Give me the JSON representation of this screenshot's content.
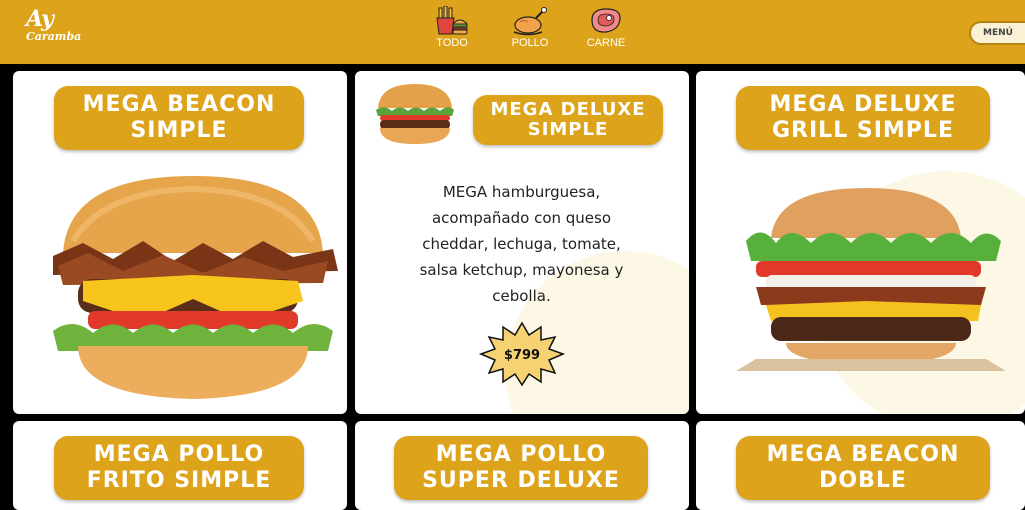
{
  "header": {
    "logo_line1": "Ay",
    "logo_line2": "Caramba",
    "nav": [
      {
        "label": "TODO",
        "icon": "fries-burger-icon"
      },
      {
        "label": "POLLO",
        "icon": "roast-chicken-icon"
      },
      {
        "label": "CARNE",
        "icon": "steak-icon"
      }
    ],
    "menu_label": "MENÚ"
  },
  "cards": [
    {
      "title_line1": "MEGA BEACON",
      "title_line2": "SIMPLE"
    },
    {
      "title_line1": "MEGA DELUXE",
      "title_line2": "SIMPLE",
      "description": [
        "MEGA hamburguesa,",
        "acompañado con queso",
        "cheddar, lechuga, tomate,",
        "salsa ketchup, mayonesa y",
        "cebolla."
      ],
      "price": "$799"
    },
    {
      "title_line1": "MEGA DELUXE",
      "title_line2": "GRILL SIMPLE"
    },
    {
      "title_line1": "MEGA POLLO",
      "title_line2": "FRITO SIMPLE"
    },
    {
      "title_line1": "MEGA POLLO",
      "title_line2": "SUPER DELUXE"
    },
    {
      "title_line1": "MEGA BEACON",
      "title_line2": "DOBLE"
    }
  ],
  "colors": {
    "brand": "#dda31a",
    "card": "#ffffff",
    "background": "#000000"
  }
}
